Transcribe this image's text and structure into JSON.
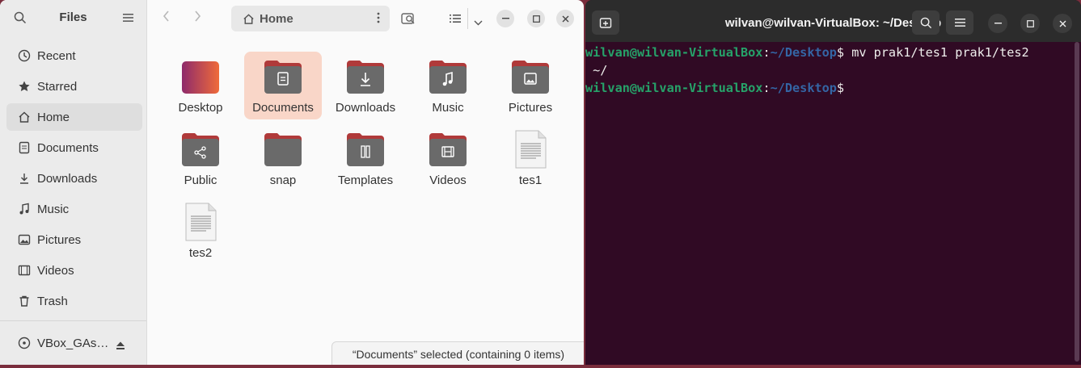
{
  "files": {
    "sidebar": {
      "title": "Files",
      "items": [
        {
          "label": "Recent",
          "icon": "clock-icon"
        },
        {
          "label": "Starred",
          "icon": "star-icon"
        },
        {
          "label": "Home",
          "icon": "home-icon",
          "active": true
        },
        {
          "label": "Documents",
          "icon": "document-icon"
        },
        {
          "label": "Downloads",
          "icon": "download-icon"
        },
        {
          "label": "Music",
          "icon": "music-icon"
        },
        {
          "label": "Pictures",
          "icon": "picture-icon"
        },
        {
          "label": "Videos",
          "icon": "video-icon"
        },
        {
          "label": "Trash",
          "icon": "trash-icon"
        }
      ],
      "device": {
        "label": "VBox_GAs…",
        "icon": "disc-icon"
      }
    },
    "toolbar": {
      "path": "Home"
    },
    "grid": [
      {
        "label": "Desktop",
        "kind": "desktop"
      },
      {
        "label": "Documents",
        "kind": "folder-doc",
        "selected": true
      },
      {
        "label": "Downloads",
        "kind": "folder-download"
      },
      {
        "label": "Music",
        "kind": "folder-music"
      },
      {
        "label": "Pictures",
        "kind": "folder-picture"
      },
      {
        "label": "Public",
        "kind": "folder-share"
      },
      {
        "label": "snap",
        "kind": "folder"
      },
      {
        "label": "Templates",
        "kind": "folder-template"
      },
      {
        "label": "Videos",
        "kind": "folder-video"
      },
      {
        "label": "tes1",
        "kind": "file"
      },
      {
        "label": "tes2",
        "kind": "file"
      }
    ],
    "status": "“Documents” selected  (containing 0 items)"
  },
  "terminal": {
    "title": "wilvan@wilvan-VirtualBox: ~/Desktop",
    "lines": [
      {
        "user": "wilvan@wilvan-VirtualBox",
        "sep": ":",
        "path": "~/Desktop",
        "prompt": "$",
        "cmd": " mv prak1/tes1 prak1/tes2"
      },
      {
        "text": " ~/"
      },
      {
        "user": "wilvan@wilvan-VirtualBox",
        "sep": ":",
        "path": "~/Desktop",
        "prompt": "$",
        "cmd": ""
      }
    ]
  },
  "colors": {
    "accent_orange": "#e95420",
    "folder_top": "#c7162b",
    "terminal_bg": "#300a24",
    "prompt_user": "#26a269",
    "prompt_path": "#3465a4"
  }
}
